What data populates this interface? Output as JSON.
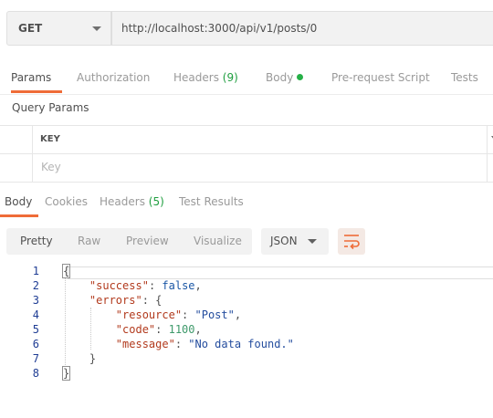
{
  "request": {
    "method": "GET",
    "url": "http://localhost:3000/api/v1/posts/0"
  },
  "request_tabs": {
    "params": "Params",
    "authorization": "Authorization",
    "headers": "Headers",
    "headers_count": "(9)",
    "body": "Body",
    "prerequest": "Pre-request Script",
    "tests": "Tests"
  },
  "query_params": {
    "title": "Query Params",
    "key_header": "KEY",
    "key_placeholder": "Key"
  },
  "response_tabs": {
    "body": "Body",
    "cookies": "Cookies",
    "headers": "Headers",
    "headers_count": "(5)",
    "test_results": "Test Results"
  },
  "view_modes": {
    "pretty": "Pretty",
    "raw": "Raw",
    "preview": "Preview",
    "visualize": "Visualize",
    "format": "JSON"
  },
  "code": {
    "line_numbers": [
      "1",
      "2",
      "3",
      "4",
      "5",
      "6",
      "7",
      "8"
    ],
    "open_brace": "{",
    "success_key": "\"success\"",
    "success_value": "false",
    "errors_key": "\"errors\"",
    "resource_key": "\"resource\"",
    "resource_value": "\"Post\"",
    "code_key": "\"code\"",
    "code_value": "1100",
    "message_key": "\"message\"",
    "message_value": "\"No data found.\"",
    "inner_close": "}",
    "close_brace": "}"
  }
}
